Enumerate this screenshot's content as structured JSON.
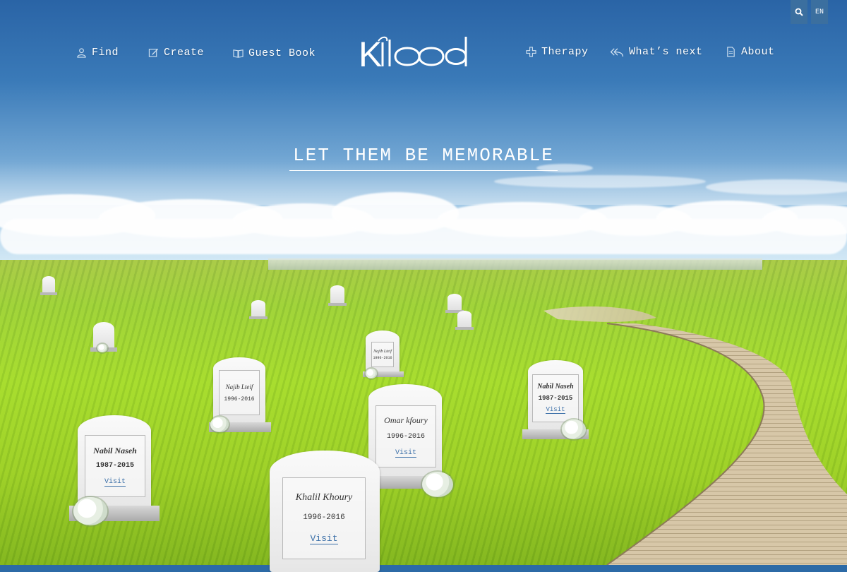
{
  "header": {
    "nav_left": [
      {
        "label": "Find",
        "icon": "user-icon"
      },
      {
        "label": "Create",
        "icon": "edit-icon"
      },
      {
        "label": "Guest Book",
        "icon": "book-icon"
      }
    ],
    "nav_right": [
      {
        "label": "Therapy",
        "icon": "cross-icon"
      },
      {
        "label": "What’s next",
        "icon": "reply-all-icon"
      },
      {
        "label": "About",
        "icon": "document-icon"
      }
    ],
    "logo_text": "Khlood",
    "search_icon": "search-icon",
    "language": "EN"
  },
  "hero": {
    "tagline": "LET THEM BE MEMORABLE"
  },
  "memorials": [
    {
      "name": "Najib Lteif",
      "dates": "1996-2016"
    },
    {
      "name": "Najib Lteif",
      "dates": "1996-2016"
    },
    {
      "name": "Nabil Naseh",
      "dates": "1987-2015",
      "visit": "Visit"
    },
    {
      "name": "Omar kfoury",
      "dates": "1996-2016",
      "visit": "Visit"
    },
    {
      "name": "Nabil Naseh",
      "dates": "1987-2015",
      "visit": "Visit"
    },
    {
      "name": "Khalil Khoury",
      "dates": "1996-2016",
      "visit": "Visit"
    }
  ],
  "colors": {
    "sky_top": "#2a64a6",
    "grass": "#a6dc2e",
    "link": "#3b6fa8",
    "top_button": "#3b6f9f"
  }
}
